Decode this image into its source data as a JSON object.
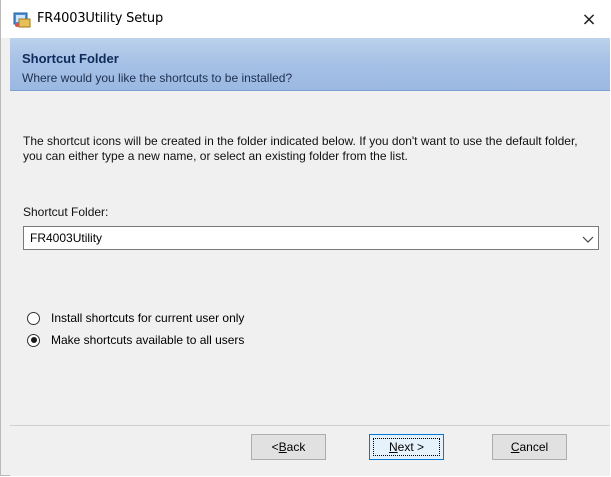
{
  "window": {
    "title": "FR4003Utility Setup",
    "close_glyph": "×",
    "icon": "installer-icon"
  },
  "header": {
    "title": "Shortcut Folder",
    "subtitle": "Where would you like the shortcuts to be installed?"
  },
  "body": {
    "description": "The shortcut icons will be created in the folder indicated below. If you don't want to use the default folder, you can either type a new name, or select an existing folder from the list.",
    "folder_label": "Shortcut Folder:",
    "folder_value": "FR4003Utility",
    "options": [
      {
        "label": "Install shortcuts for current user only",
        "checked": false
      },
      {
        "label": "Make shortcuts available to all users",
        "checked": true
      }
    ]
  },
  "buttons": {
    "back": {
      "prefix": "< ",
      "accel": "B",
      "rest": "ack"
    },
    "next": {
      "accel": "N",
      "rest": "ext >"
    },
    "cancel": {
      "accel": "C",
      "rest": "ancel"
    }
  },
  "colors": {
    "header_band": "#a9c3e6",
    "header_title": "#102a5c",
    "default_button_border": "#0078d7"
  }
}
